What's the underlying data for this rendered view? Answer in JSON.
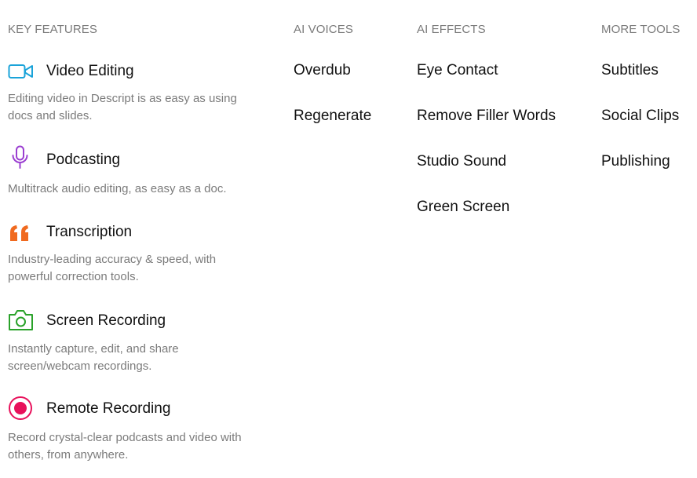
{
  "key_features": {
    "header": "KEY FEATURES",
    "items": [
      {
        "icon": "video-camera-icon",
        "title": "Video Editing",
        "desc": "Editing video in Descript is as easy as using docs and slides.",
        "color": "#1aa3d9"
      },
      {
        "icon": "microphone-icon",
        "title": "Podcasting",
        "desc": "Multitrack audio editing, as easy as a doc.",
        "color": "#9b3fd1"
      },
      {
        "icon": "quote-icon",
        "title": "Transcription",
        "desc": "Industry-leading accuracy & speed, with powerful correction tools.",
        "color": "#f06a1f"
      },
      {
        "icon": "camera-icon",
        "title": "Screen Recording",
        "desc": "Instantly capture, edit, and share screen/webcam recordings.",
        "color": "#2aa22a"
      },
      {
        "icon": "record-icon",
        "title": "Remote Recording",
        "desc": "Record crystal-clear podcasts and video with others, from anywhere.",
        "color": "#e8115b"
      }
    ]
  },
  "ai_voices": {
    "header": "AI VOICES",
    "items": [
      "Overdub",
      "Regenerate"
    ]
  },
  "ai_effects": {
    "header": "AI EFFECTS",
    "items": [
      "Eye Contact",
      "Remove Filler Words",
      "Studio Sound",
      "Green Screen"
    ]
  },
  "more_tools": {
    "header": "MORE TOOLS",
    "items": [
      "Subtitles",
      "Social Clips",
      "Publishing"
    ]
  }
}
